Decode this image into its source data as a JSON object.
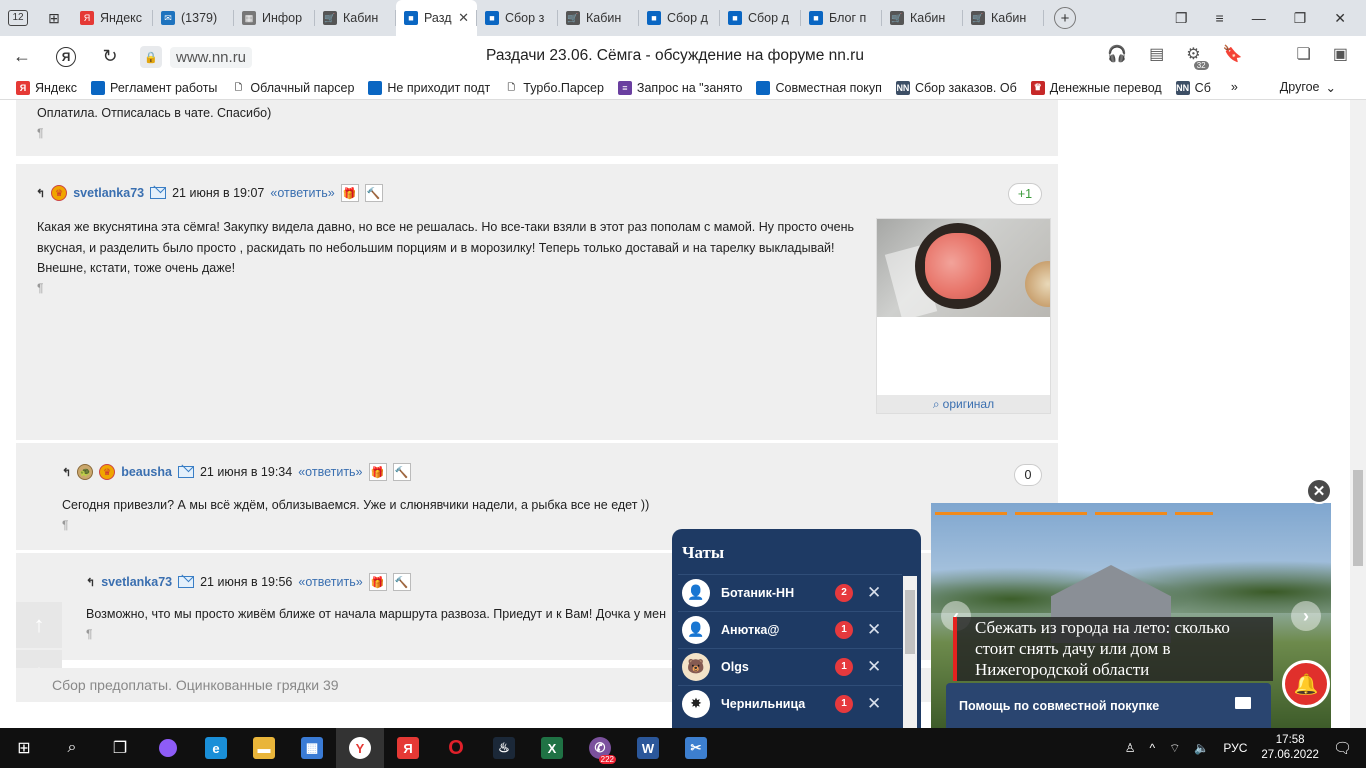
{
  "browser": {
    "tab_count": "12",
    "tabs": [
      {
        "label": "Яндекс",
        "color": "#e53935",
        "glyph": "Я"
      },
      {
        "label": "(1379)",
        "color": "#1e73be",
        "glyph": "✉"
      },
      {
        "label": "Инфор",
        "color": "#777777",
        "glyph": "▦"
      },
      {
        "label": "Кабин",
        "color": "#555555",
        "glyph": "🛒"
      },
      {
        "label": "Разд",
        "color": "#0a66c2",
        "glyph": "■",
        "active": true
      },
      {
        "label": "Сбор з",
        "color": "#0a66c2",
        "glyph": "■"
      },
      {
        "label": "Кабин",
        "color": "#555555",
        "glyph": "🛒"
      },
      {
        "label": "Сбор д",
        "color": "#0a66c2",
        "glyph": "■"
      },
      {
        "label": "Сбор д",
        "color": "#0a66c2",
        "glyph": "■"
      },
      {
        "label": "Блог п",
        "color": "#0a66c2",
        "glyph": "■"
      },
      {
        "label": "Кабин",
        "color": "#555555",
        "glyph": "🛒"
      },
      {
        "label": "Кабин",
        "color": "#555555",
        "glyph": "🛒"
      }
    ],
    "url": "www.nn.ru",
    "page_title": "Раздачи 23.06. Сёмга - обсуждение на форуме nn.ru",
    "badge_count": "32",
    "bookmarks": [
      {
        "label": "Яндекс",
        "color": "#e53935",
        "glyph": "Я"
      },
      {
        "label": "Регламент работы",
        "color": "#0a66c2",
        "glyph": ""
      },
      {
        "label": "Облачный парсер",
        "color": "#ffffff",
        "glyph": "🗋"
      },
      {
        "label": "Не приходит подт",
        "color": "#0a66c2",
        "glyph": ""
      },
      {
        "label": "Турбо.Парсер",
        "color": "#ffffff",
        "glyph": "🗋"
      },
      {
        "label": "Запрос на \"занято",
        "color": "#6a3fa0",
        "glyph": "≡"
      },
      {
        "label": "Совместная покуп",
        "color": "#0a66c2",
        "glyph": ""
      },
      {
        "label": "Сбор заказов. Об",
        "color": "#3d4f66",
        "glyph": "NN"
      },
      {
        "label": "Денежные перевод",
        "color": "#c62828",
        "glyph": "♛"
      },
      {
        "label": "Сб",
        "color": "#3d4f66",
        "glyph": "NN"
      }
    ],
    "bookmarks_more": "Другое"
  },
  "forum": {
    "prev_post_text": "Оплатила. Отписалась в чате. Спасибо)",
    "paragraph_mark": "¶",
    "posts": [
      {
        "user": "svetlanka73",
        "date": "21 июня в 19:07",
        "reply": "«ответить»",
        "rating": "+1",
        "text": "Какая же вкуснятина эта сёмга! Закупку видела давно, но все не решалась. Но все-таки взяли в этот раз пополам с мамой. Ну просто очень вкусная, и разделить было просто , раскидать по небольшим порциям и в морозилку! Теперь только доставай и на тарелку выкладывай! Внешне, кстати, тоже очень даже!",
        "photo_link": "оригинал"
      },
      {
        "user": "beausha",
        "date": "21 июня в 19:34",
        "reply": "«ответить»",
        "rating": "0",
        "text": "Сегодня привезли? А мы всё ждём, облизываемся. Уже и слюнявчики надели, а рыбка все не едет ))"
      },
      {
        "user": "svetlanka73",
        "date": "21 июня в 19:56",
        "reply": "«ответить»",
        "text": "Возможно, что мы просто живём ближе от начала маршрута развоза. Приедут и к Вам! Дочка у мен"
      }
    ],
    "footer_text": "Сбор предоплаты. Оцинкованные грядки 39"
  },
  "chats": {
    "title": "Чаты",
    "items": [
      {
        "name": "Ботаник-НН",
        "count": "2"
      },
      {
        "name": "Анютка@",
        "count": "1"
      },
      {
        "name": "Olgs",
        "count": "1"
      },
      {
        "name": "Чернильница",
        "count": "1"
      }
    ]
  },
  "ad": {
    "headline": "Сбежать из города на лето: сколько стоит снять дачу или дом в Нижегородской области"
  },
  "help": {
    "label": "Помощь по совместной покупке"
  },
  "taskbar": {
    "viber_badge": "222",
    "lang": "РУС",
    "time": "17:58",
    "date": "27.06.2022"
  }
}
